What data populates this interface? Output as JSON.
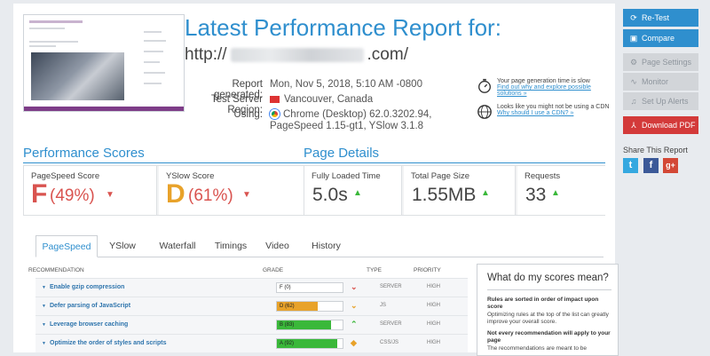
{
  "header": {
    "title": "Latest Performance Report for:",
    "url_prefix": "http://",
    "url_suffix": ".com/"
  },
  "report_info": {
    "generated_label": "Report generated:",
    "generated_value": "Mon, Nov 5, 2018, 5:10 AM -0800",
    "region_label": "Test Server Region:",
    "region_value": "Vancouver, Canada",
    "using_label": "Using:",
    "using_value": "Chrome (Desktop) 62.0.3202.94, PageSpeed 1.15-gt1, YSlow 3.1.8"
  },
  "notices": [
    {
      "text": "Your page generation time is slow",
      "link": "Find out why and explore possible solutions »"
    },
    {
      "text": "Looks like you might not be using a CDN",
      "link": "Why should I use a CDN? »"
    }
  ],
  "performance": {
    "title": "Performance Scores",
    "pagespeed_label": "PageSpeed Score",
    "pagespeed_grade": "F",
    "pagespeed_pct": "(49%)",
    "yslow_label": "YSlow Score",
    "yslow_grade": "D",
    "yslow_pct": "(61%)"
  },
  "details": {
    "title": "Page Details",
    "loaded_label": "Fully Loaded Time",
    "loaded_value": "5.0s",
    "size_label": "Total Page Size",
    "size_value": "1.55MB",
    "requests_label": "Requests",
    "requests_value": "33"
  },
  "tabs": [
    "PageSpeed",
    "YSlow",
    "Waterfall",
    "Timings",
    "Video",
    "History"
  ],
  "table": {
    "headers": {
      "recommendation": "RECOMMENDATION",
      "grade": "GRADE",
      "type": "TYPE",
      "priority": "PRIORITY"
    },
    "rows": [
      {
        "name": "Enable gzip compression",
        "grade": "F (0)",
        "score": 0,
        "color": "#d9534f",
        "symbol": "⌄",
        "type": "SERVER",
        "priority": "HIGH"
      },
      {
        "name": "Defer parsing of JavaScript",
        "grade": "D (62)",
        "score": 62,
        "color": "#e8a22a",
        "symbol": "⌄",
        "type": "JS",
        "priority": "HIGH"
      },
      {
        "name": "Leverage browser caching",
        "grade": "B (83)",
        "score": 83,
        "color": "#3ab83a",
        "symbol": "⌃",
        "type": "SERVER",
        "priority": "HIGH"
      },
      {
        "name": "Optimize the order of styles and scripts",
        "grade": "A (92)",
        "score": 92,
        "color": "#3ab83a",
        "symbol": "◆",
        "type": "CSS/JS",
        "priority": "HIGH"
      }
    ]
  },
  "scores_panel": {
    "heading": "What do my scores mean?",
    "b1": "Rules are sorted in order of impact upon score",
    "t1": "Optimizing rules at the top of the list can greatly improve your overall score.",
    "b2": "Not every recommendation will apply to your page",
    "t2": "The recommendations are meant to be"
  },
  "sidebar": {
    "retest": "Re-Test",
    "compare": "Compare",
    "page_settings": "Page Settings",
    "monitor": "Monitor",
    "alerts": "Set Up Alerts",
    "download": "Download PDF",
    "share": "Share This Report"
  },
  "colors": {
    "accent": "#2f8fce",
    "grade_f": "#d9534f",
    "grade_d": "#e8a22a",
    "good": "#3ab83a",
    "pdf": "#d33a3a"
  }
}
